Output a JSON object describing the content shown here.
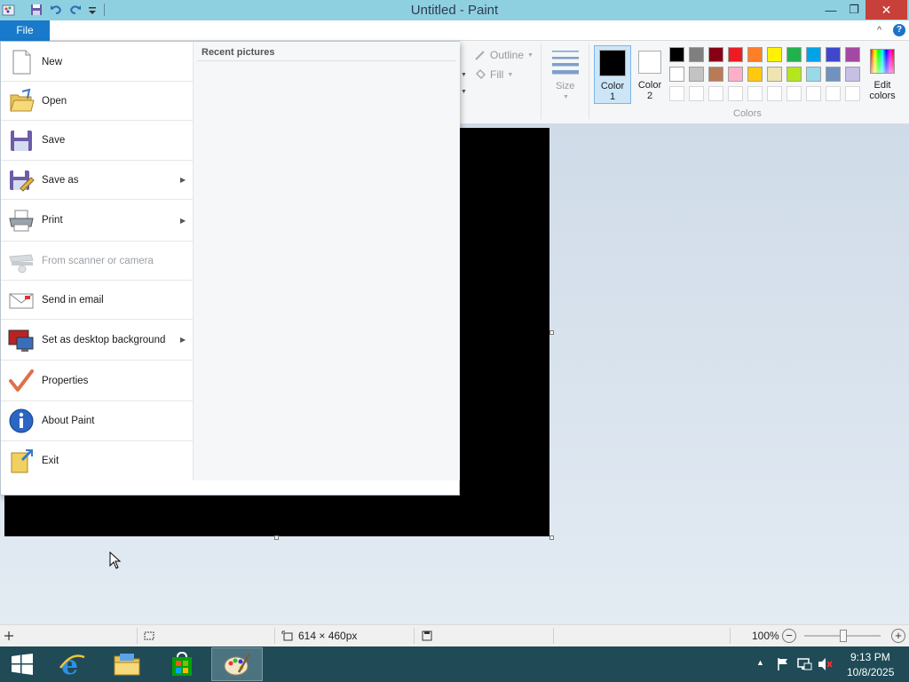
{
  "window": {
    "title": "Untitled - Paint",
    "minimize": "—",
    "restore": "❐",
    "close": "✕",
    "help": "?",
    "ribbon_collapse": "^"
  },
  "file_tab": {
    "label": "File"
  },
  "file_menu": {
    "items": [
      {
        "label": "New",
        "icon": "new-file-icon",
        "submenu": false,
        "enabled": true
      },
      {
        "label": "Open",
        "icon": "open-folder-icon",
        "submenu": false,
        "enabled": true
      },
      {
        "label": "Save",
        "icon": "save-icon",
        "submenu": false,
        "enabled": true
      },
      {
        "label": "Save as",
        "icon": "save-as-icon",
        "submenu": true,
        "enabled": true
      },
      {
        "label": "Print",
        "icon": "printer-icon",
        "submenu": true,
        "enabled": true
      },
      {
        "label": "From scanner or camera",
        "icon": "scanner-icon",
        "submenu": false,
        "enabled": false
      },
      {
        "label": "Send in email",
        "icon": "email-icon",
        "submenu": false,
        "enabled": true
      },
      {
        "label": "Set as desktop background",
        "icon": "desktop-background-icon",
        "submenu": true,
        "enabled": true
      },
      {
        "label": "Properties",
        "icon": "properties-checkmark-icon",
        "submenu": false,
        "enabled": true
      },
      {
        "label": "About Paint",
        "icon": "info-icon",
        "submenu": false,
        "enabled": true
      },
      {
        "label": "Exit",
        "icon": "exit-icon",
        "submenu": false,
        "enabled": true
      }
    ],
    "submenu_arrow": "▶",
    "recent_title": "Recent pictures"
  },
  "ribbon": {
    "outline_label": "Outline",
    "fill_label": "Fill",
    "size_label": "Size",
    "color1_label_a": "Color",
    "color1_label_b": "1",
    "color2_label_a": "Color",
    "color2_label_b": "2",
    "colors_group_label": "Colors",
    "edit_colors_a": "Edit",
    "edit_colors_b": "colors",
    "color1": "#000000",
    "color2": "#ffffff",
    "palette_row1": [
      "#000000",
      "#7f7f7f",
      "#880015",
      "#ed1c24",
      "#ff7f27",
      "#fff200",
      "#22b14c",
      "#00a2e8",
      "#3f48cc",
      "#a349a4"
    ],
    "palette_row2": [
      "#ffffff",
      "#c3c3c3",
      "#b97a57",
      "#ffaec9",
      "#ffc90e",
      "#efe4b0",
      "#b5e61d",
      "#99d9ea",
      "#7092be",
      "#c8bfe7"
    ]
  },
  "canvas": {
    "background": "#000000"
  },
  "status": {
    "dimensions": "614 × 460px",
    "zoom": "100%",
    "zoom_out": "−",
    "zoom_in": "+"
  },
  "taskbar": {
    "time": "9:13 PM",
    "date": "10/8/2025"
  }
}
